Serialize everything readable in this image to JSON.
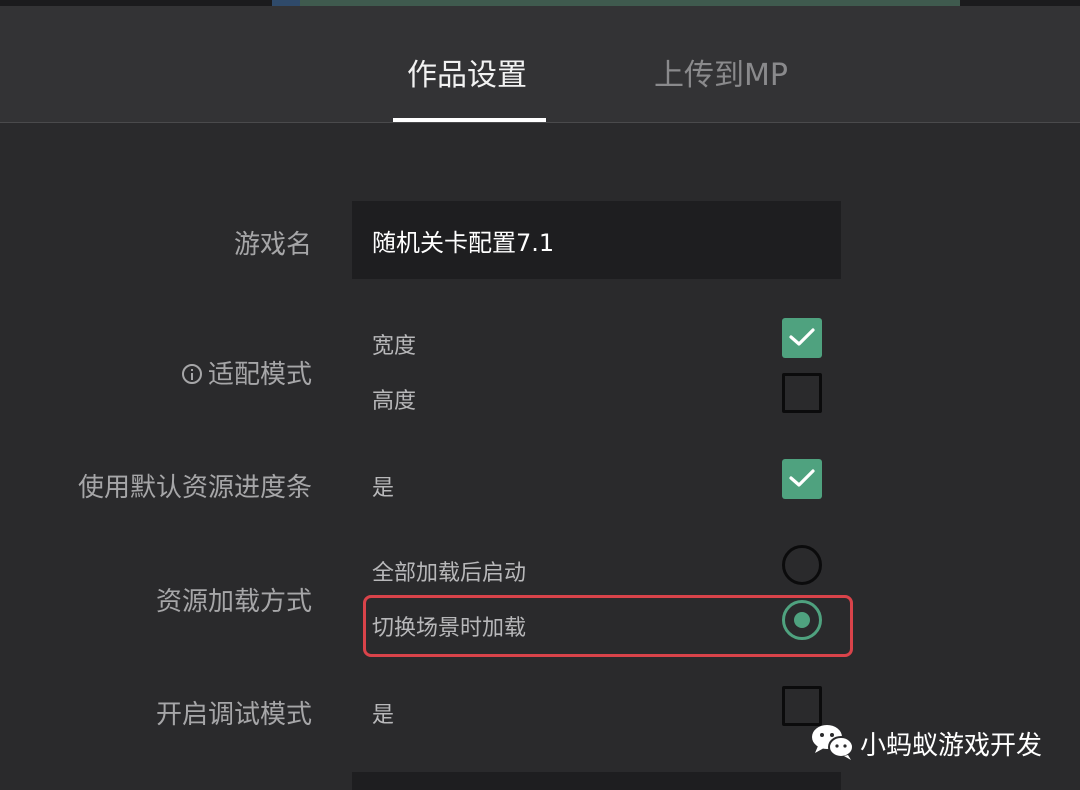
{
  "tabs": [
    {
      "label": "作品设置",
      "active": true
    },
    {
      "label": "上传到MP",
      "active": false
    }
  ],
  "fields": {
    "game_name": {
      "label": "游戏名",
      "value": "随机关卡配置7.1"
    },
    "fit_mode": {
      "label": "适配模式",
      "icon": "info-icon",
      "options": [
        {
          "label": "宽度",
          "checked": true
        },
        {
          "label": "高度",
          "checked": false
        }
      ]
    },
    "default_progress": {
      "label": "使用默认资源进度条",
      "option_label": "是",
      "checked": true
    },
    "load_mode": {
      "label": "资源加载方式",
      "options": [
        {
          "label": "全部加载后启动",
          "selected": false
        },
        {
          "label": "切换场景时加载",
          "selected": true
        }
      ]
    },
    "debug_mode": {
      "label": "开启调试模式",
      "option_label": "是",
      "checked": false
    }
  },
  "watermark": {
    "text": "小蚂蚁游戏开发",
    "icon": "wechat-icon"
  },
  "colors": {
    "accent": "#4fa27f",
    "highlight": "#d9434a",
    "background": "#2a2a2c"
  }
}
